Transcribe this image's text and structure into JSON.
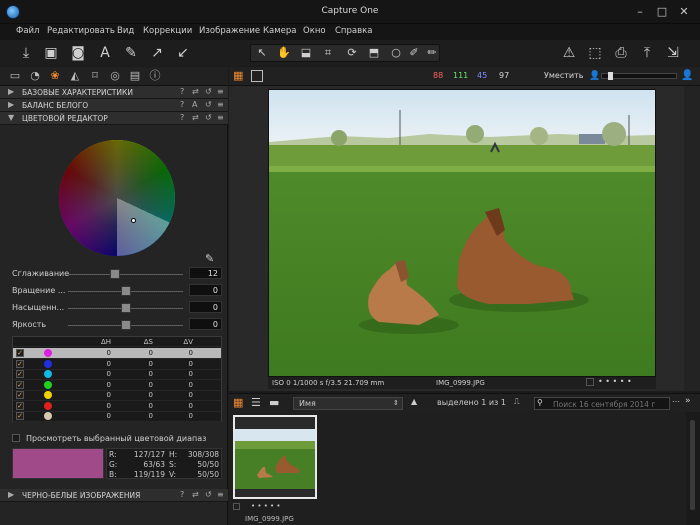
{
  "window": {
    "title": "Capture One",
    "min": "–",
    "max": "□",
    "close": "✕"
  },
  "menu": [
    "Файл",
    "Редактировать",
    "Вид",
    "Коррекции",
    "Изображение",
    "Камера",
    "Окно",
    "Справка"
  ],
  "viewer_bar": {
    "r": "88",
    "g": "111",
    "b": "45",
    "a": "97",
    "fit": "Уместить"
  },
  "sections": {
    "basic": "БАЗОВЫЕ ХАРАКТЕРИСТИКИ",
    "wb": "БАЛАНС БЕЛОГО",
    "color_editor": "ЦВЕТОВОЙ РЕДАКТОР",
    "bw": "ЧЕРНО-БЕЛЫЕ ИЗОБРАЖЕНИЯ"
  },
  "sliders": [
    {
      "label": "Сглаживание",
      "value": "12",
      "level": 0.4
    },
    {
      "label": "Вращение ...",
      "value": "0",
      "level": 0.5
    },
    {
      "label": "Насыщенн...",
      "value": "0",
      "level": 0.5
    },
    {
      "label": "Яркость",
      "value": "0",
      "level": 0.5
    }
  ],
  "color_table": {
    "headers": [
      "ΔH",
      "ΔS",
      "ΔV"
    ],
    "rows": [
      {
        "color": "#e020e0",
        "h": "0",
        "s": "0",
        "v": "0",
        "selected": true
      },
      {
        "color": "#2030e0",
        "h": "0",
        "s": "0",
        "v": "0"
      },
      {
        "color": "#10b8e8",
        "h": "0",
        "s": "0",
        "v": "0"
      },
      {
        "color": "#20d020",
        "h": "0",
        "s": "0",
        "v": "0"
      },
      {
        "color": "#f0d000",
        "h": "0",
        "s": "0",
        "v": "0"
      },
      {
        "color": "#e02020",
        "h": "0",
        "s": "0",
        "v": "0"
      },
      {
        "color": "#d8c8b0",
        "h": "0",
        "s": "0",
        "v": "0"
      }
    ]
  },
  "view_selected": "Просмотреть выбранный цветовой диапаз",
  "readout": {
    "r": "R:",
    "r_val": "127/127",
    "g": "G:",
    "g_val": "63/63",
    "b": "B:",
    "b_val": "119/119",
    "h": "H:",
    "h_val": "308/308",
    "s": "S:",
    "s_val": "50/50",
    "v": "V:",
    "v_val": "50/50",
    "swatch": "#a04a8a"
  },
  "photo_info": {
    "exif": "ISO 0  1/1000 s f/3.5 21.709 mm",
    "name": "IMG_0999.JPG"
  },
  "browser": {
    "sort": "Имя",
    "selected": "выделено 1 из 1",
    "search_placeholder": "Поиск 16 сентября 2014 г"
  },
  "thumb_label": "IMG_0999.JPG"
}
